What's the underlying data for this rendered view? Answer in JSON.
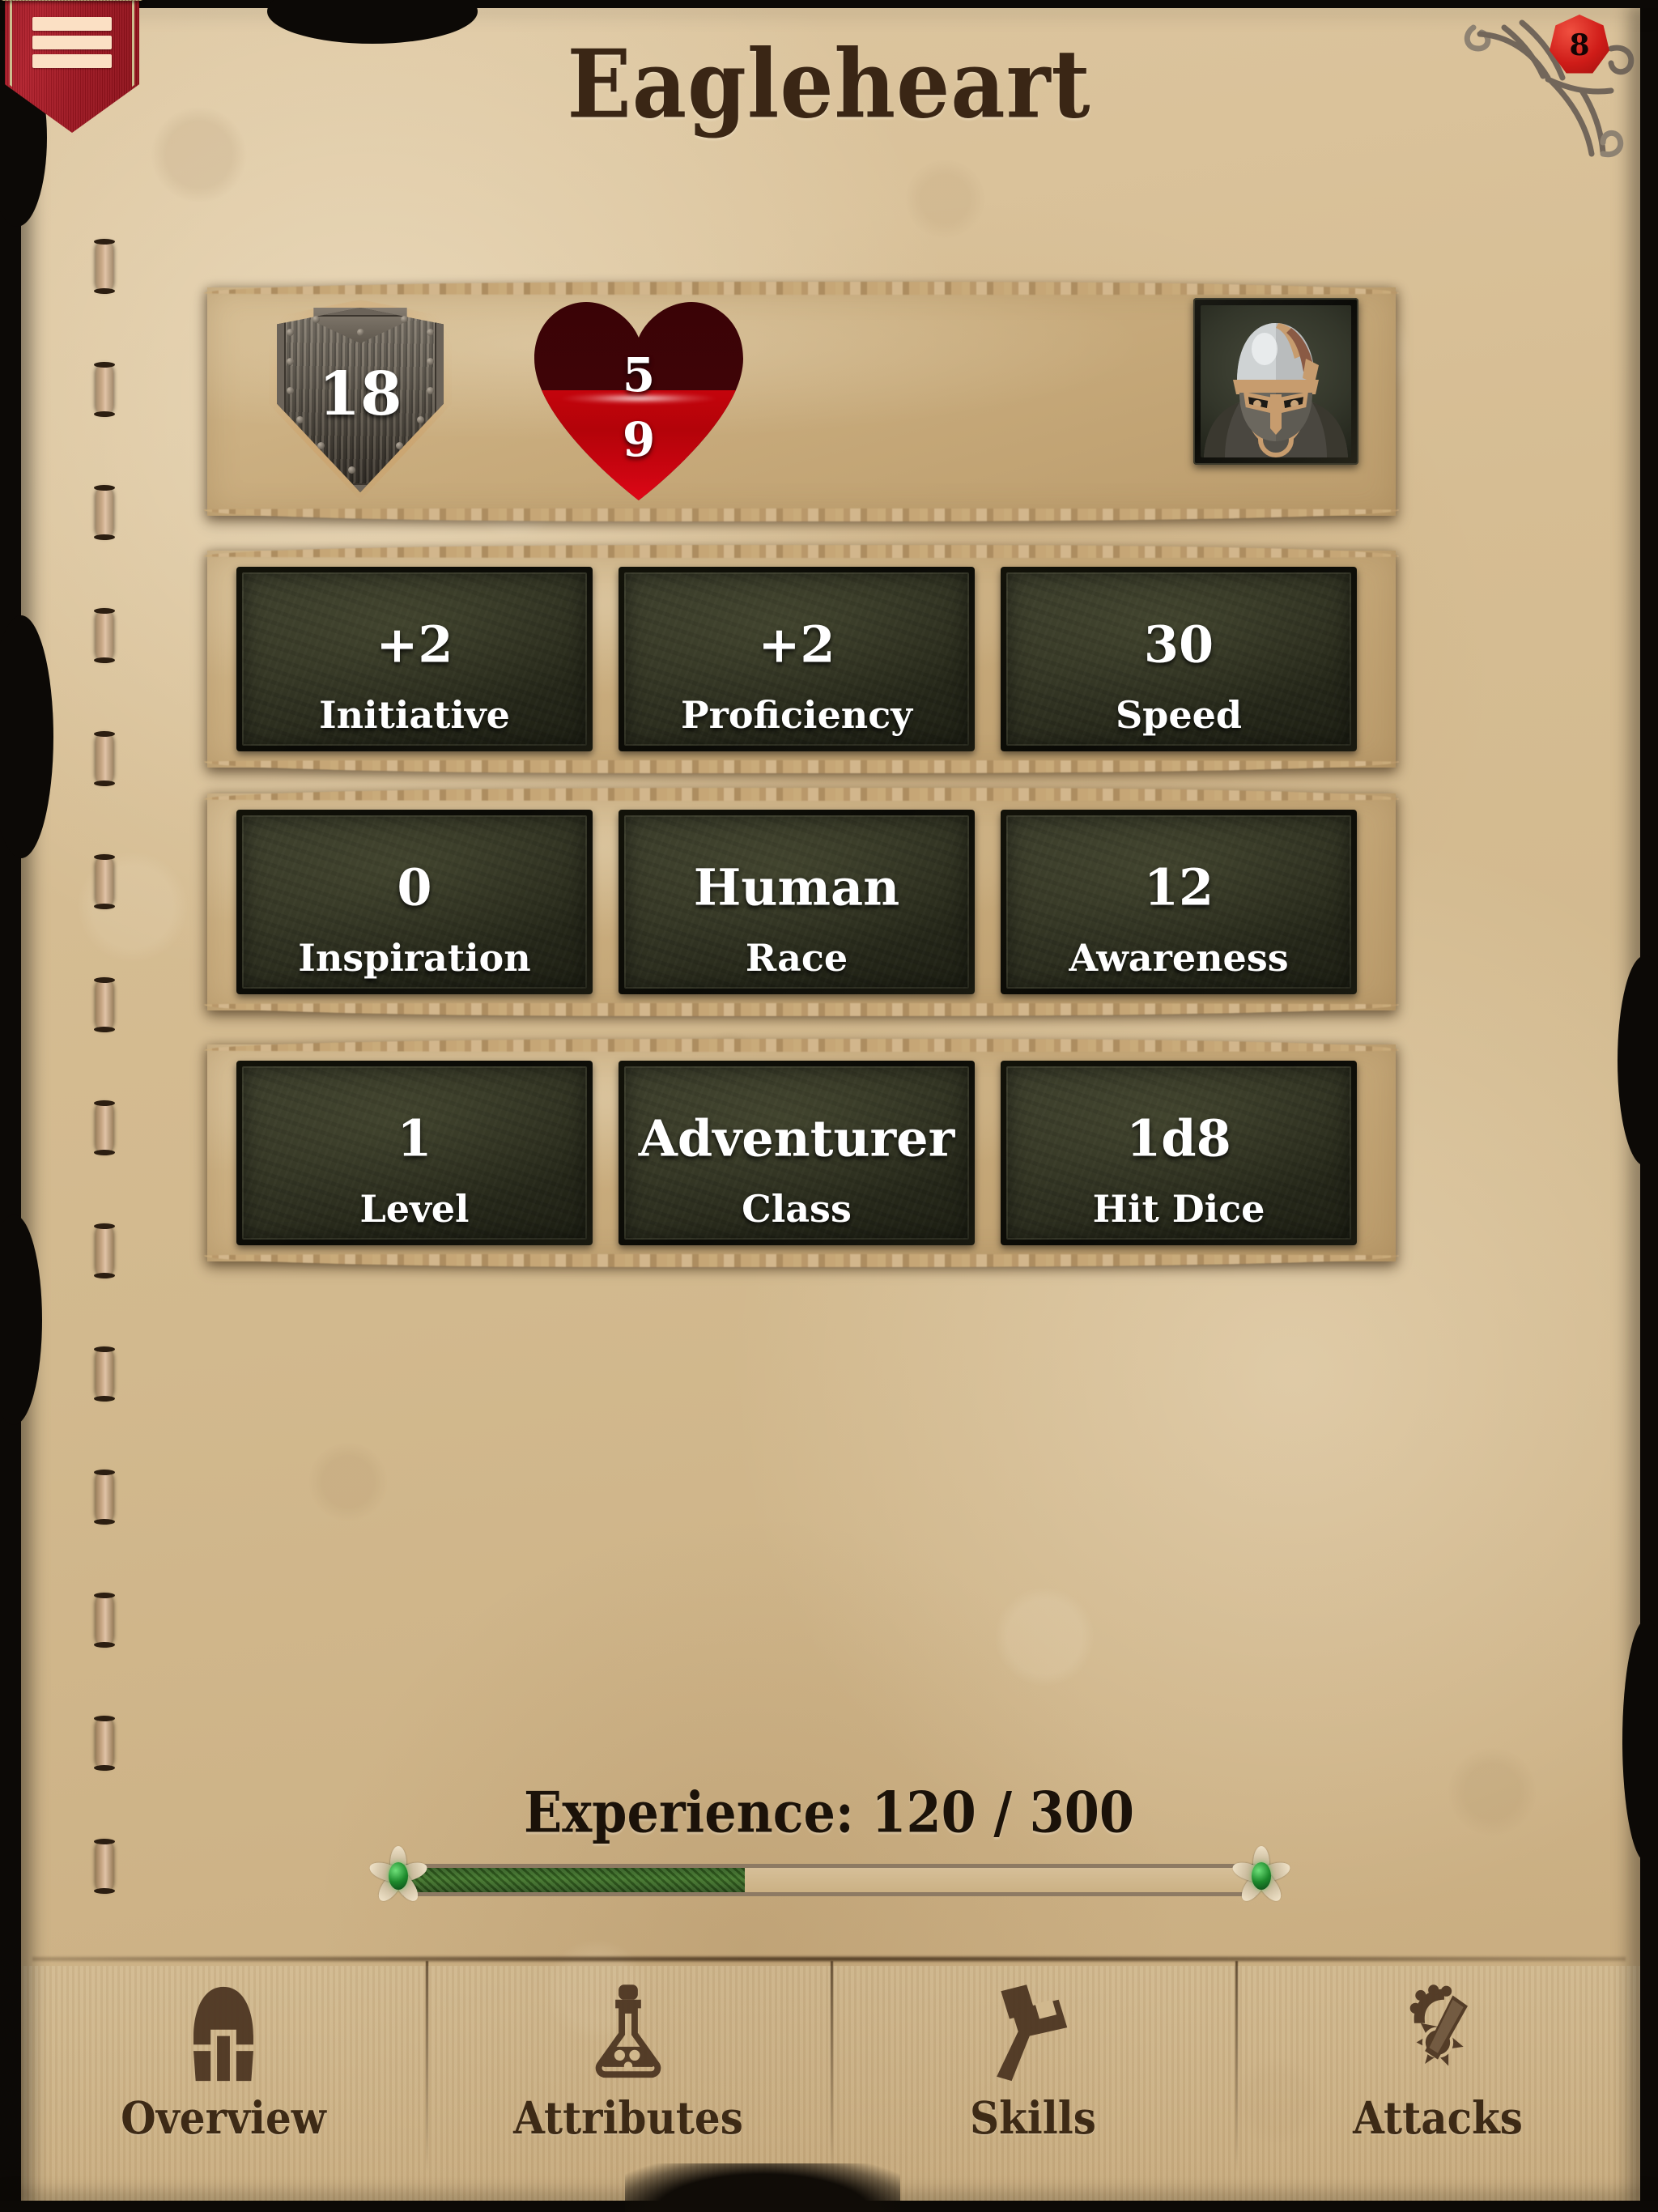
{
  "header": {
    "character_name": "Eagleheart",
    "menu_icon": "hamburger-menu-icon",
    "dice_icon": "polyhedral-die-icon",
    "dice_value": "8"
  },
  "vitals": {
    "armor_class": "18",
    "armor_class_icon": "shield-icon",
    "hp_current": "5",
    "hp_max": "9",
    "hp_icon": "heart-icon",
    "hp_fill_percent": 55,
    "portrait_icon": "knight-portrait"
  },
  "stats": [
    {
      "value": "+2",
      "label": "Initiative"
    },
    {
      "value": "+2",
      "label": "Proficiency"
    },
    {
      "value": "30",
      "label": "Speed"
    },
    {
      "value": "0",
      "label": "Inspiration"
    },
    {
      "value": "Human",
      "label": "Race"
    },
    {
      "value": "12",
      "label": "Awareness"
    },
    {
      "value": "1",
      "label": "Level"
    },
    {
      "value": "Adventurer",
      "label": "Class"
    },
    {
      "value": "1d8",
      "label": "Hit Dice"
    }
  ],
  "experience": {
    "label": "Experience: 120 / 300",
    "current": 120,
    "max": 300,
    "percent": 40
  },
  "nav": {
    "tabs": [
      {
        "label": "Overview",
        "icon": "helmet-icon"
      },
      {
        "label": "Attributes",
        "icon": "potion-flask-icon"
      },
      {
        "label": "Skills",
        "icon": "hammer-icon"
      },
      {
        "label": "Attacks",
        "icon": "flail-mace-icon"
      }
    ],
    "active": "Overview"
  },
  "colors": {
    "parchment": "#d2b98e",
    "ink": "#3a2615",
    "banner_red": "#a01724",
    "banner_trim": "#cdbe8e",
    "tile_slate": "#333524",
    "hp_red": "#c4040c",
    "hp_empty": "#3a0306",
    "xp_green": "#3f7528",
    "die_red": "#cf1c18"
  }
}
